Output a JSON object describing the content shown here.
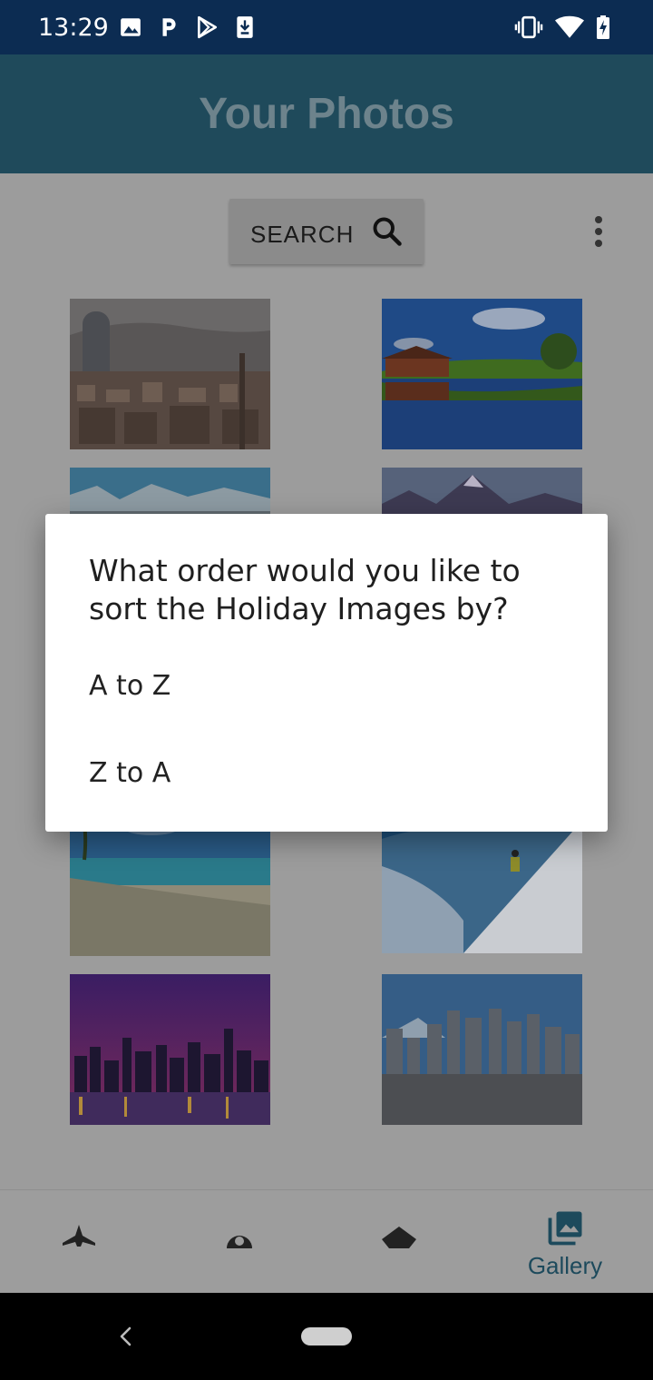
{
  "status_bar": {
    "time": "13:29",
    "left_icons": [
      "image-icon",
      "parking-p-icon",
      "play-store-icon",
      "download-icon"
    ],
    "right_icons": [
      "vibrate-icon",
      "wifi-icon",
      "battery-charging-icon"
    ]
  },
  "app_bar": {
    "title": "Your Photos"
  },
  "toolbar": {
    "search_label": "SEARCH"
  },
  "photos": [
    {
      "name": "photo-city-barcelona"
    },
    {
      "name": "photo-lake-house"
    },
    {
      "name": "photo-snowy-mountains"
    },
    {
      "name": "photo-mountain-peaks"
    },
    {
      "name": "photo-tropical-beach"
    },
    {
      "name": "photo-skier-slope"
    },
    {
      "name": "photo-night-skyline"
    },
    {
      "name": "photo-city-mount-fuji"
    }
  ],
  "bottom_nav": {
    "items": [
      {
        "icon": "airplane-icon"
      },
      {
        "icon": "place-icon"
      },
      {
        "icon": "layers-icon"
      },
      {
        "icon": "gallery-icon",
        "label": "Gallery"
      }
    ]
  },
  "dialog": {
    "title": "What order would you like to sort the Holiday Images by?",
    "options": [
      "A to Z",
      "Z to A"
    ]
  },
  "colors": {
    "status_bar": "#0c2c52",
    "app_bar_dimmed": "#1f4a5b",
    "accent_dimmed": "#1d4a5c",
    "dialog_bg": "#ffffff"
  }
}
